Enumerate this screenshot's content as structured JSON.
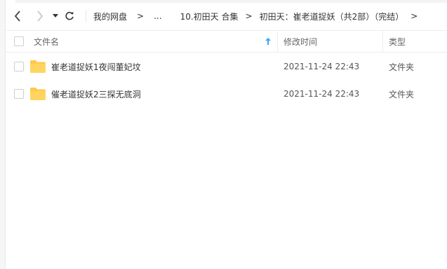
{
  "breadcrumb": {
    "items": [
      "我的网盘",
      "...",
      "10.初田天 合集",
      "初田天：崔老道捉妖（共2部）（完结）"
    ],
    "separator": ">"
  },
  "table": {
    "headers": {
      "name": "文件名",
      "modified": "修改时间",
      "type": "类型"
    },
    "sort_column": "name",
    "sort_direction": "ascending",
    "rows": [
      {
        "name": "崔老道捉妖1夜闯董妃坟",
        "modified": "2021-11-24 22:43",
        "type": "文件夹"
      },
      {
        "name": "催老道捉妖2三探无底洞",
        "modified": "2021-11-24 22:43",
        "type": "文件夹"
      }
    ]
  },
  "icons": {
    "back": "chevron-left-icon",
    "forward": "chevron-right-icon",
    "history": "dropdown-caret-icon",
    "refresh": "refresh-icon",
    "folder": "folder-icon",
    "sort": "sort-up-arrow-icon"
  },
  "colors": {
    "folder": "#ffc94d",
    "sort_arrow": "#3aa3f5",
    "text": "#333333",
    "muted": "#666666",
    "border": "#eeeeee"
  }
}
